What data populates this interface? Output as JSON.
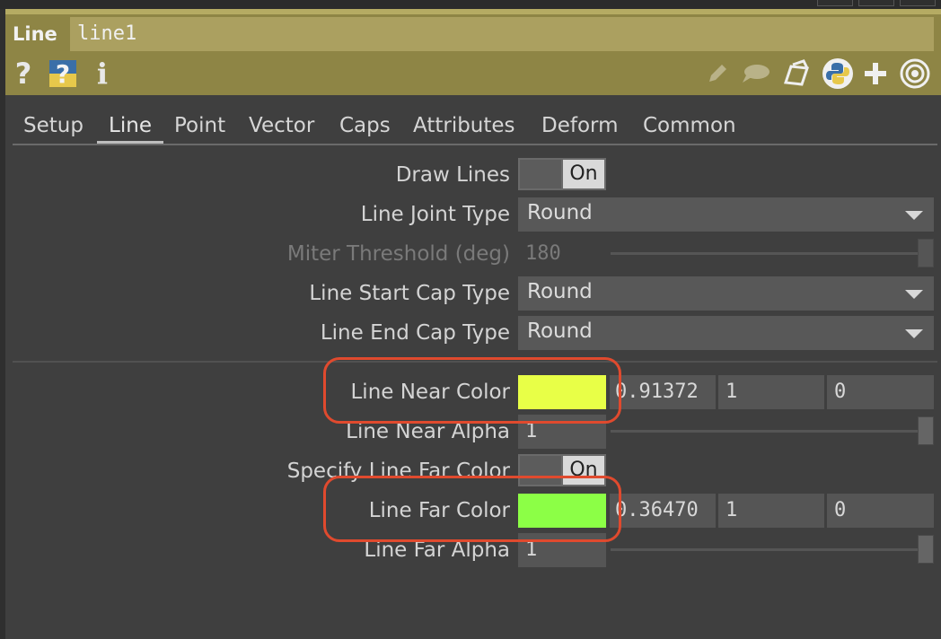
{
  "header": {
    "op_type": "Line",
    "op_name": "line1",
    "help_icon": "?",
    "info_icon": "i"
  },
  "header_icons": [
    "help-icon",
    "python-help-icon",
    "info-icon",
    "pencil-icon",
    "comment-icon",
    "clone-icon",
    "python-icon",
    "plus-icon",
    "viewer-icon"
  ],
  "tabs": [
    "Setup",
    "Line",
    "Point",
    "Vector",
    "Caps",
    "Attributes",
    "Deform",
    "Common"
  ],
  "active_tab": "Line",
  "params": {
    "draw_lines": {
      "label": "Draw Lines",
      "value": "On"
    },
    "line_joint_type": {
      "label": "Line Joint Type",
      "value": "Round"
    },
    "miter_threshold": {
      "label": "Miter Threshold (deg)",
      "value": "180",
      "slider_fraction": 1.0
    },
    "line_start_cap_type": {
      "label": "Line Start Cap Type",
      "value": "Round"
    },
    "line_end_cap_type": {
      "label": "Line End Cap Type",
      "value": "Round"
    },
    "line_near_color": {
      "label": "Line Near Color",
      "swatch": "#e8ff47",
      "r": "0.91372",
      "g": "1",
      "b": "0"
    },
    "line_near_alpha": {
      "label": "Line Near Alpha",
      "value": "1",
      "slider_fraction": 1.0
    },
    "specify_line_far_color": {
      "label": "Specify Line Far Color",
      "value": "On"
    },
    "line_far_color": {
      "label": "Line Far Color",
      "swatch": "#8cff46",
      "r": "0.36470",
      "g": "1",
      "b": "0"
    },
    "line_far_alpha": {
      "label": "Line Far Alpha",
      "value": "1",
      "slider_fraction": 1.0
    }
  },
  "colors": {
    "header_bg": "#8e8545",
    "panel_bg": "#3f3f3f",
    "highlight": "#e04a2e"
  }
}
